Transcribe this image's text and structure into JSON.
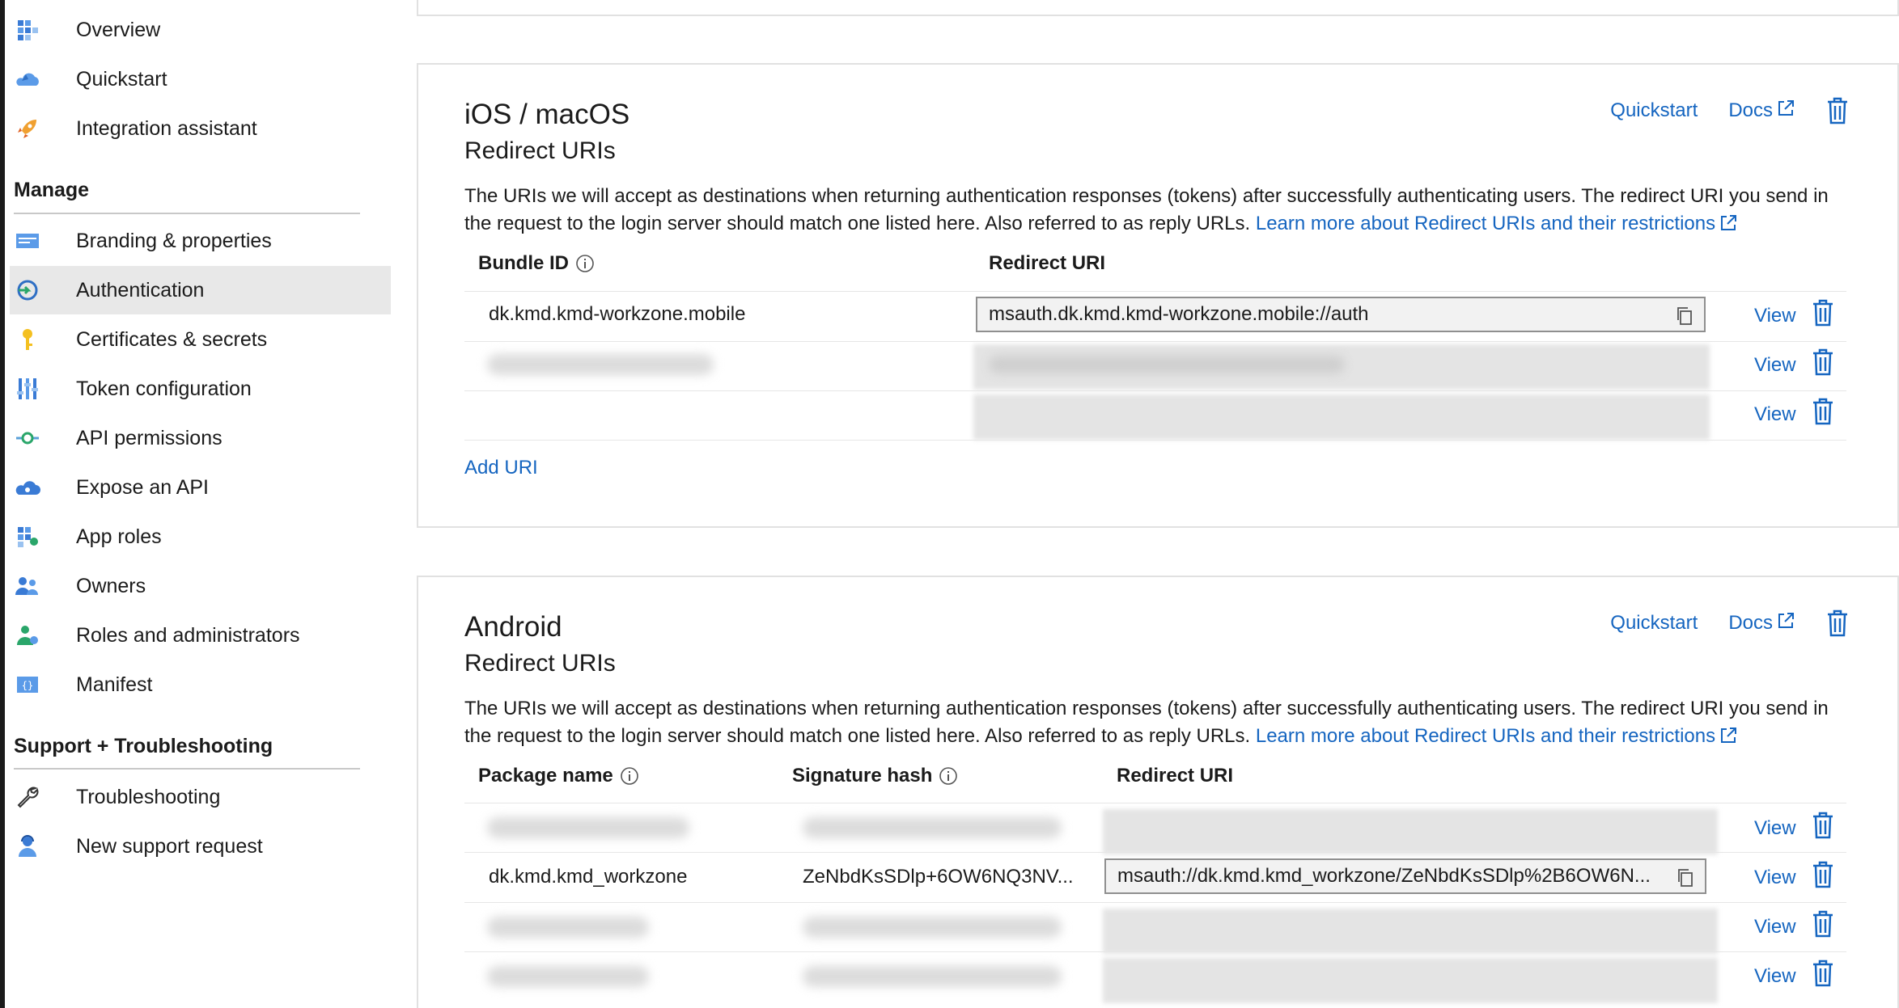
{
  "sidebar": {
    "items_top": [
      {
        "label": "Overview",
        "icon": "overview-grid-icon"
      },
      {
        "label": "Quickstart",
        "icon": "quickstart-cloud-icon"
      },
      {
        "label": "Integration assistant",
        "icon": "rocket-icon"
      }
    ],
    "manage_heading": "Manage",
    "manage_items": [
      {
        "label": "Branding & properties",
        "icon": "branding-icon"
      },
      {
        "label": "Authentication",
        "icon": "authentication-icon",
        "active": true
      },
      {
        "label": "Certificates & secrets",
        "icon": "key-icon"
      },
      {
        "label": "Token configuration",
        "icon": "token-bars-icon"
      },
      {
        "label": "API permissions",
        "icon": "api-permissions-icon"
      },
      {
        "label": "Expose an API",
        "icon": "cloud-icon"
      },
      {
        "label": "App roles",
        "icon": "app-roles-grid-icon"
      },
      {
        "label": "Owners",
        "icon": "owners-people-icon"
      },
      {
        "label": "Roles and administrators",
        "icon": "roles-admin-icon"
      },
      {
        "label": "Manifest",
        "icon": "manifest-icon"
      }
    ],
    "support_heading": "Support + Troubleshooting",
    "support_items": [
      {
        "label": "Troubleshooting",
        "icon": "wrench-icon"
      },
      {
        "label": "New support request",
        "icon": "support-person-icon"
      }
    ]
  },
  "ios": {
    "title": "iOS / macOS",
    "subtitle": "Redirect URIs",
    "description": "The URIs we will accept as destinations when returning authentication responses (tokens) after successfully authenticating users. The redirect URI you send in the request to the login server should match one listed here. Also referred to as reply URLs.",
    "learn_more": "Learn more about Redirect URIs and their restrictions",
    "quickstart": "Quickstart",
    "docs": "Docs",
    "col_bundle": "Bundle ID",
    "col_redirect": "Redirect URI",
    "rows": [
      {
        "bundle": "dk.kmd.kmd-workzone.mobile",
        "uri": "msauth.dk.kmd.kmd-workzone.mobile://auth",
        "view": "View"
      },
      {
        "view": "View"
      },
      {
        "view": "View"
      }
    ],
    "add_uri": "Add URI"
  },
  "android": {
    "title": "Android",
    "subtitle": "Redirect URIs",
    "description": "The URIs we will accept as destinations when returning authentication responses (tokens) after successfully authenticating users. The redirect URI you send in the request to the login server should match one listed here. Also referred to as reply URLs.",
    "learn_more": "Learn more about Redirect URIs and their restrictions",
    "quickstart": "Quickstart",
    "docs": "Docs",
    "col_package": "Package name",
    "col_signature": "Signature hash",
    "col_redirect": "Redirect URI",
    "rows": [
      {
        "view": "View"
      },
      {
        "package": "dk.kmd.kmd_workzone",
        "signature": "ZeNbdKsSDlp+6OW6NQ3NV...",
        "uri": "msauth://dk.kmd.kmd_workzone/ZeNbdKsSDlp%2B6OW6N...",
        "view": "View"
      },
      {
        "view": "View"
      },
      {
        "view": "View"
      }
    ]
  },
  "colors": {
    "link": "#1565c0",
    "active_bg": "#e8e8e8"
  }
}
